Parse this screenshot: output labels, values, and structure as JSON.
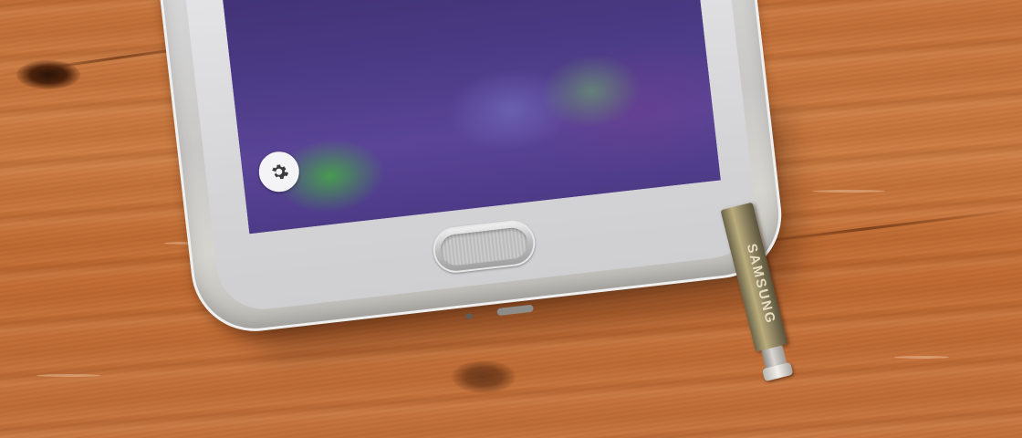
{
  "scene": {
    "description_label": "",
    "phone": {
      "home_button_icon": "fingerprint-home-button",
      "settings_icon": "gear-icon",
      "screen_colors": {
        "base": "#4a3a84",
        "accent_green": "#46aa46",
        "accent_purple": "#6e3c8c"
      }
    },
    "stylus": {
      "brand_text": "SAMSUNG",
      "color": "#b9ac7c"
    },
    "table": {
      "color": "#c9763e"
    }
  }
}
